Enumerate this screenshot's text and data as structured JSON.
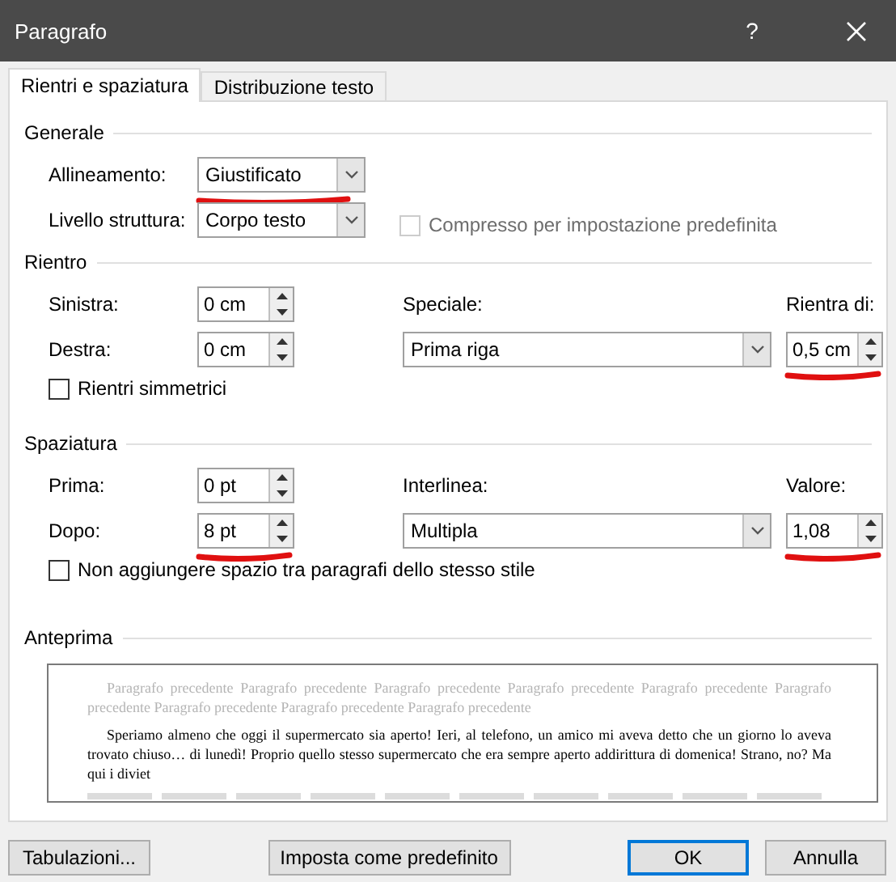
{
  "window": {
    "title": "Paragrafo",
    "help": "?"
  },
  "tabs": [
    {
      "label": "Rientri e spaziatura",
      "selected": true
    },
    {
      "label": "Distribuzione testo",
      "selected": false
    }
  ],
  "generale": {
    "heading": "Generale",
    "allineamento": {
      "label": "Allineamento:",
      "value": "Giustificato",
      "highlighted": true
    },
    "livello": {
      "label": "Livello struttura:",
      "value": "Corpo testo"
    },
    "compresso": {
      "label": "Compresso per impostazione predefinita",
      "checked": false,
      "disabled": true
    }
  },
  "rientro": {
    "heading": "Rientro",
    "sinistra": {
      "label": "Sinistra:",
      "value": "0 cm"
    },
    "destra": {
      "label": "Destra:",
      "value": "0 cm"
    },
    "speciale": {
      "label": "Speciale:",
      "value": "Prima riga"
    },
    "rientra_di": {
      "label": "Rientra di:",
      "value": "0,5 cm",
      "highlighted": true
    },
    "simmetrici": {
      "label": "Rientri simmetrici",
      "checked": false,
      "disabled": false
    }
  },
  "spaziatura": {
    "heading": "Spaziatura",
    "prima": {
      "label": "Prima:",
      "value": "0 pt"
    },
    "dopo": {
      "label": "Dopo:",
      "value": "8 pt",
      "highlighted": true
    },
    "interlinea": {
      "label": "Interlinea:",
      "value": "Multipla"
    },
    "valore": {
      "label": "Valore:",
      "value": "1,08",
      "highlighted": true
    },
    "non_aggiungere": {
      "label": "Non aggiungere spazio tra paragrafi dello stesso stile",
      "checked": false,
      "disabled": false
    }
  },
  "anteprima": {
    "heading": "Anteprima",
    "previous": "Paragrafo precedente Paragrafo precedente Paragrafo precedente Paragrafo precedente Paragrafo precedente Paragrafo precedente Paragrafo precedente Paragrafo precedente Paragrafo precedente",
    "sample": "Speriamo almeno che oggi il supermercato sia aperto! Ieri, al telefono, un amico mi aveva detto che un giorno lo aveva trovato chiuso… di lunedì! Proprio quello stesso supermercato che era sempre aperto addirittura di domenica! Strano, no? Ma qui i diviet"
  },
  "buttons": [
    {
      "label": "Tabulazioni...",
      "kind": "normal"
    },
    {
      "label": "Imposta come predefinito",
      "kind": "normal"
    },
    {
      "label": "OK",
      "kind": "default"
    },
    {
      "label": "Annulla",
      "kind": "normal"
    }
  ]
}
